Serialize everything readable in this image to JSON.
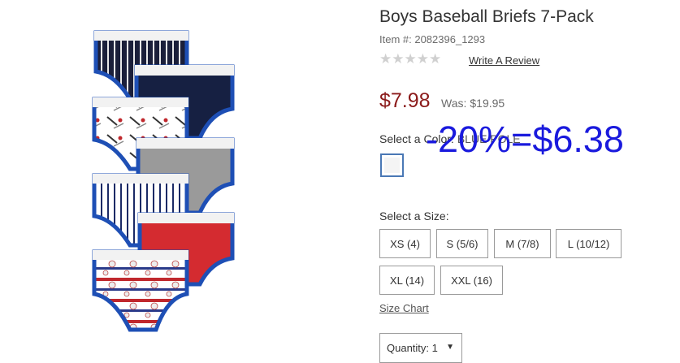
{
  "product": {
    "title": "Boys Baseball Briefs 7-Pack",
    "item_number": "Item #: 2082396_1293",
    "rating_stars": "★★★★★",
    "write_review": "Write A Review",
    "price": "$7.98",
    "was_label": "Was:",
    "was_price": "$19.95",
    "promo_overlay": "-20%=$6.38",
    "select_color_label": "Select a Color:",
    "color_name": "BLUE POLE",
    "select_size_label": "Select a Size:",
    "sizes": [
      "XS (4)",
      "S (5/6)",
      "M (7/8)",
      "L (10/12)",
      "XL (14)",
      "XXL (16)"
    ],
    "size_chart": "Size Chart",
    "quantity_label": "Quantity:",
    "quantity_value": "1"
  },
  "colors": {
    "price": "#8b1a1a",
    "promo": "#1a1add",
    "swatch_border": "#4a78b5"
  }
}
